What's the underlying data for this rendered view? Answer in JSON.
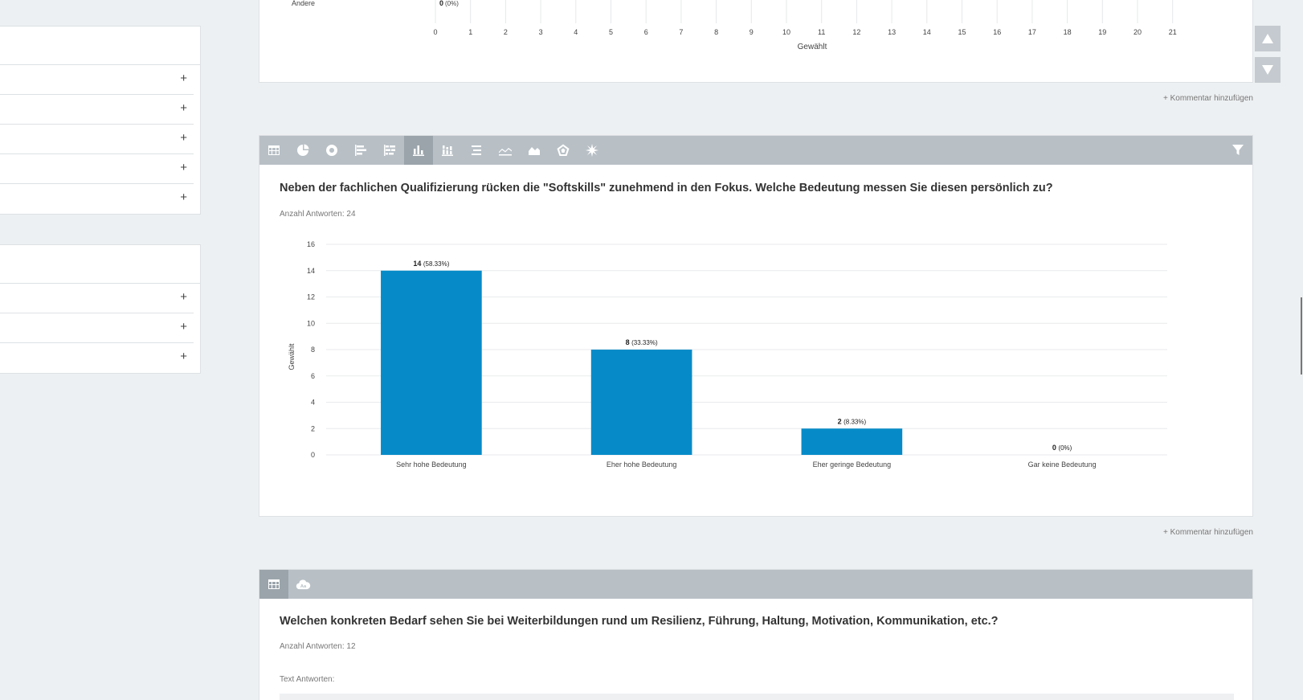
{
  "sidebar": {
    "panel1_rows": 5,
    "panel2_rows": 3,
    "plus_label": "+"
  },
  "top_chart": {
    "last_category": "Andere",
    "last_value_label": "0",
    "last_value_pct": "(0%)",
    "x_ticks": [
      "0",
      "1",
      "2",
      "3",
      "4",
      "5",
      "6",
      "7",
      "8",
      "9",
      "10",
      "11",
      "12",
      "13",
      "14",
      "15",
      "16",
      "17",
      "18",
      "19",
      "20",
      "21"
    ],
    "xlabel": "Gewählt"
  },
  "comment_label": "+ Kommentar hinzufügen",
  "question1": {
    "title": "Neben der fachlichen Qualifizierung rücken die \"Softskills\" zunehmend in den Fokus. Welche Bedeutung messen Sie diesen persönlich zu?",
    "count": "Anzahl Antworten: 24"
  },
  "question2": {
    "title": "Welchen konkreten Bedarf sehen Sie bei Weiterbildungen rund um Resilienz, Führung, Haltung, Motivation, Kommunikation, etc.?",
    "count": "Anzahl Antworten: 12",
    "text_answers_label": "Text Antworten:"
  },
  "toolbar1_icons": [
    "table-icon",
    "pie-chart-icon",
    "donut-chart-icon",
    "bar-horizontal-icon",
    "stacked-bar-horizontal-icon",
    "bar-vertical-icon",
    "stacked-bar-vertical-icon",
    "horizontal-lines-icon",
    "line-chart-icon",
    "area-chart-icon",
    "radar-chart-icon",
    "polar-chart-icon"
  ],
  "toolbar2_icons": [
    "table-icon",
    "word-cloud-icon"
  ],
  "word_cloud_glyph": "Aa",
  "colors": {
    "bar": "#068bc8",
    "toolbar": "#b8c0c6",
    "toolbar_active": "#9ba4ab"
  },
  "chart_data": {
    "type": "bar",
    "categories": [
      "Sehr hohe Bedeutung",
      "Eher hohe Bedeutung",
      "Eher geringe Bedeutung",
      "Gar keine Bedeutung"
    ],
    "values": [
      14,
      8,
      2,
      0
    ],
    "value_labels": [
      "14",
      "8",
      "2",
      "0"
    ],
    "pct_labels": [
      "(58.33%)",
      "(33.33%)",
      "(8.33%)",
      "(0%)"
    ],
    "ylabel": "Gewählt",
    "ylim": [
      0,
      16
    ],
    "y_ticks": [
      0,
      2,
      4,
      6,
      8,
      10,
      12,
      14,
      16
    ],
    "grid": true
  }
}
